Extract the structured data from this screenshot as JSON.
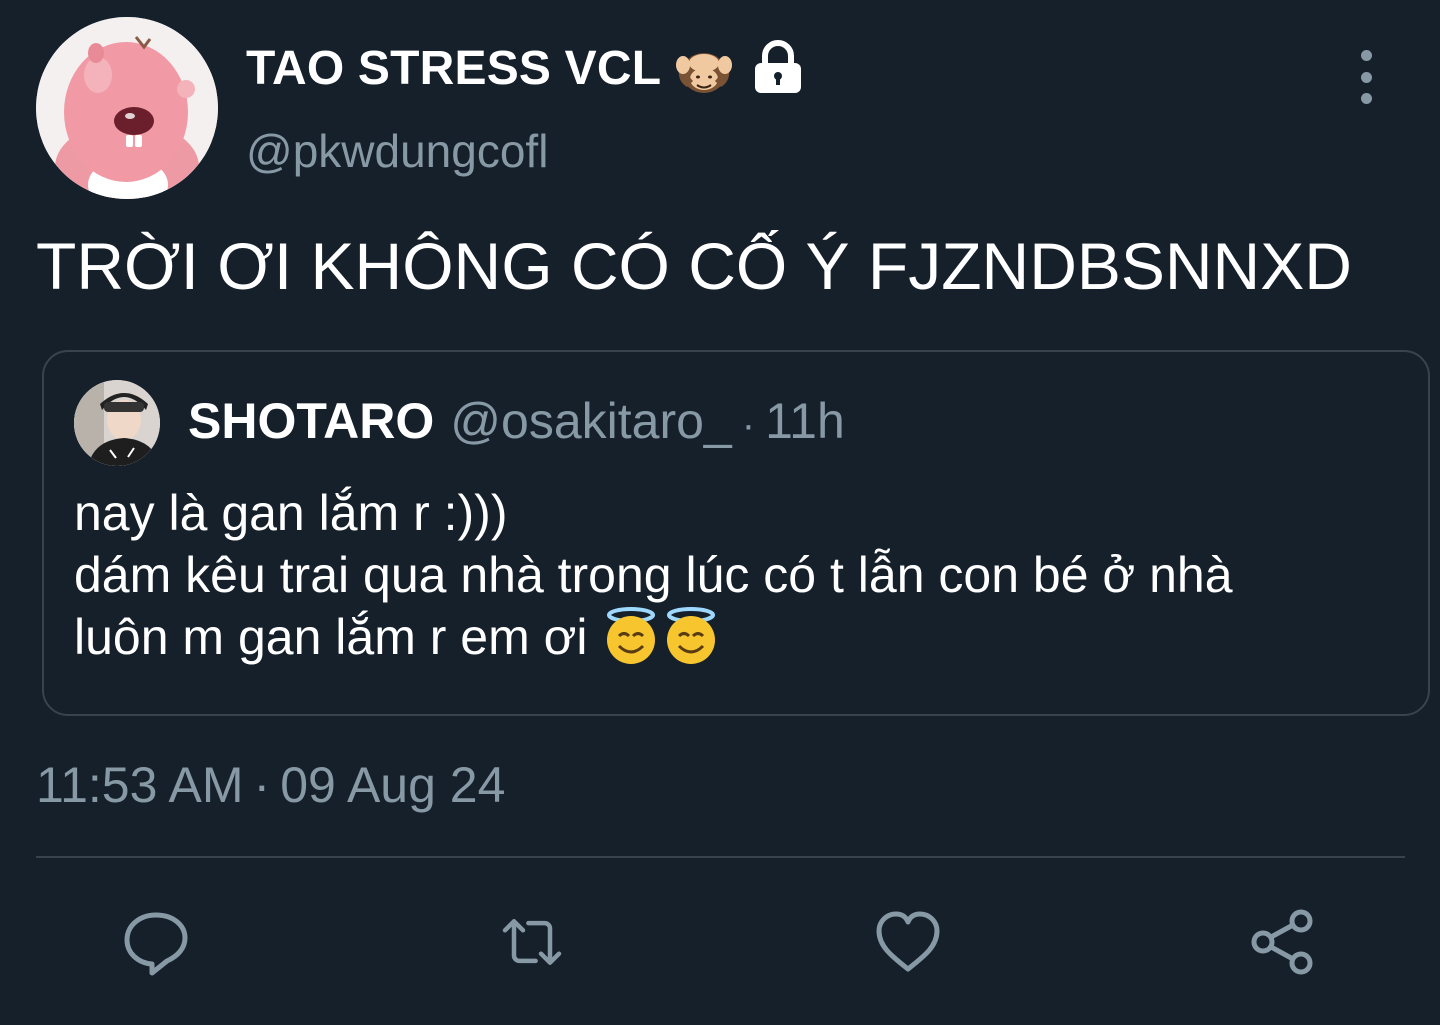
{
  "user": {
    "display_name": "TAO STRESS VCL",
    "handle": "@pkwdungcofl",
    "name_emoji": "see-no-evil-monkey-icon",
    "lock_icon": "lock-icon"
  },
  "tweet": {
    "text": "TRỜI ƠI KHÔNG CÓ CỐ Ý FJZNDBSNNXD",
    "time": "11:53 AM",
    "separator": "·",
    "date": "09 Aug 24"
  },
  "quote": {
    "name": "SHOTARO",
    "handle": "@osakitaro_",
    "separator": "·",
    "time": "11h",
    "lines": [
      "nay là gan lắm r :)))",
      "dám kêu trai qua nhà trong lúc có t lẫn con bé ở nhà",
      "luôn m gan lắm r em ơi"
    ],
    "trailing_emoji": [
      "smiling-face-with-halo-icon",
      "smiling-face-with-halo-icon"
    ]
  },
  "actions": [
    "reply-icon",
    "retweet-icon",
    "like-icon",
    "share-icon"
  ],
  "colors": {
    "background": "#15202b",
    "text": "#ffffff",
    "secondary": "#8899a6",
    "border": "#38444d"
  }
}
